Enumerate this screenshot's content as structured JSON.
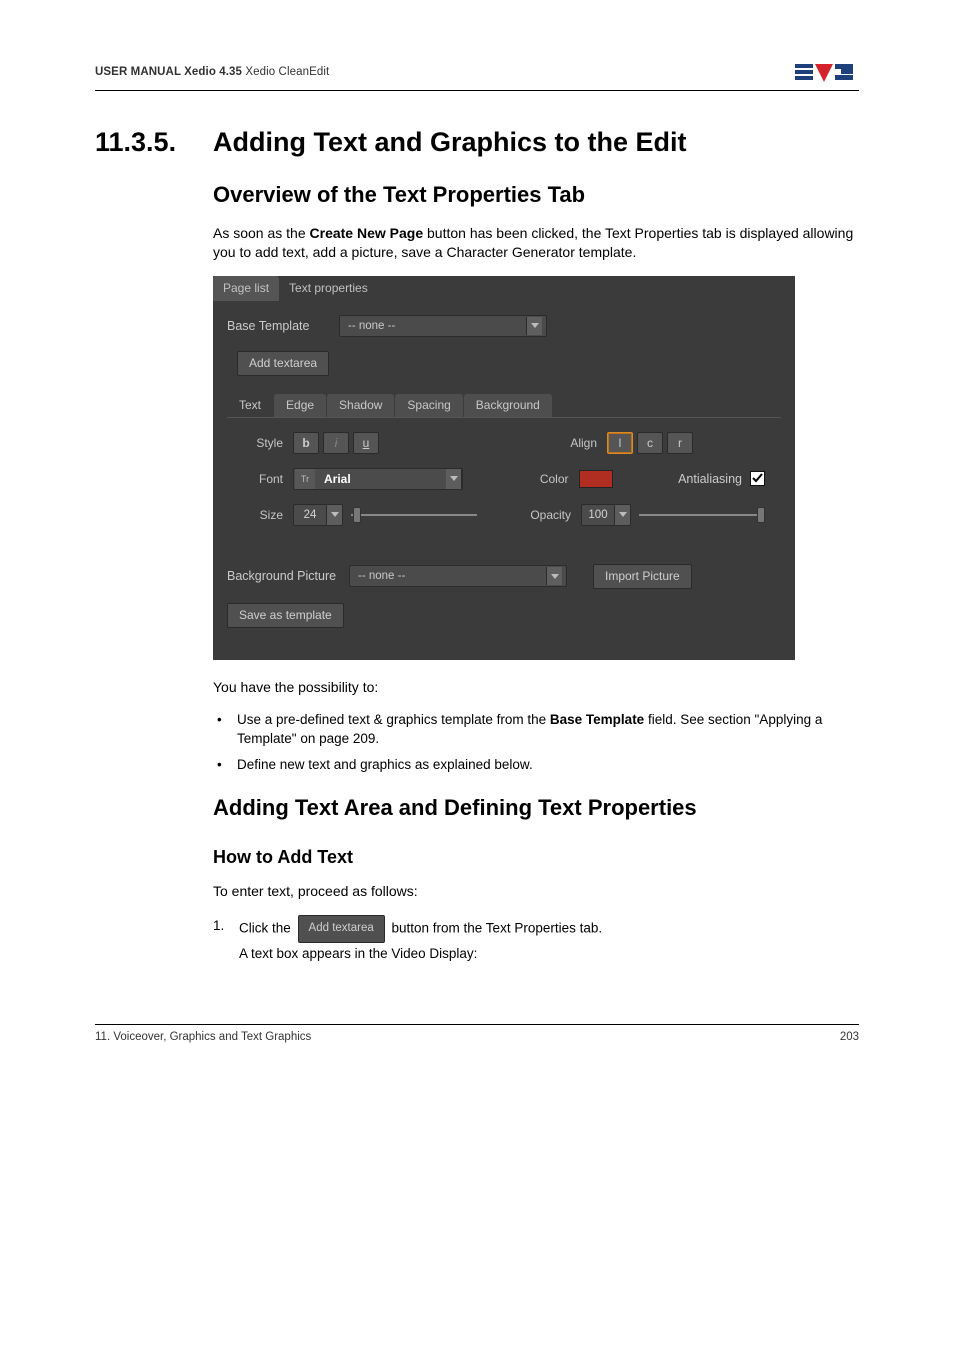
{
  "header": {
    "bold": "USER MANUAL Xedio 4.35",
    "rest": " Xedio CleanEdit"
  },
  "h1": {
    "num": "11.3.5.",
    "title": "Adding Text and Graphics to the Edit"
  },
  "h2a": "Overview of the Text Properties Tab",
  "p1a": "As soon as the ",
  "p1b": "Create New Page",
  "p1c": " button has been clicked, the Text Properties tab is displayed allowing you to add text, add a picture, save a Character Generator template.",
  "panel": {
    "tabs": {
      "page_list": "Page list",
      "text_props": "Text properties"
    },
    "base_template_label": "Base Template",
    "base_template_value": "-- none --",
    "add_textarea": "Add textarea",
    "subtabs": {
      "text": "Text",
      "edge": "Edge",
      "shadow": "Shadow",
      "spacing": "Spacing",
      "background": "Background"
    },
    "style_label": "Style",
    "style_b": "b",
    "style_i": "i",
    "style_u": "u",
    "align_label": "Align",
    "align_l": "l",
    "align_c": "c",
    "align_r": "r",
    "font_label": "Font",
    "font_tt": "Tr",
    "font_name": "Arial",
    "color_label": "Color",
    "antialias_label": "Antialiasing",
    "size_label": "Size",
    "size_value": "24",
    "opacity_label": "Opacity",
    "opacity_value": "100",
    "bgpic_label": "Background Picture",
    "bgpic_value": "-- none --",
    "import_pic": "Import Picture",
    "save_template": "Save as template"
  },
  "p2": "You have the possibility to:",
  "bullet1a": "Use a pre-defined text & graphics template from the ",
  "bullet1b": "Base Template",
  "bullet1c": " field. See section \"Applying a Template\" on page 209.",
  "bullet2": "Define new text and graphics as explained below.",
  "h2b": "Adding Text Area and Defining Text Properties",
  "h3": "How to Add Text",
  "p3": "To enter text, proceed as follows:",
  "step1_num": "1.",
  "step1a": "Click the ",
  "step1_btn": "Add textarea",
  "step1b": " button from the Text Properties tab.",
  "step1c": "A text box appears in the Video Display:",
  "footer": {
    "left": "11. Voiceover, Graphics and Text Graphics",
    "right": "203"
  }
}
